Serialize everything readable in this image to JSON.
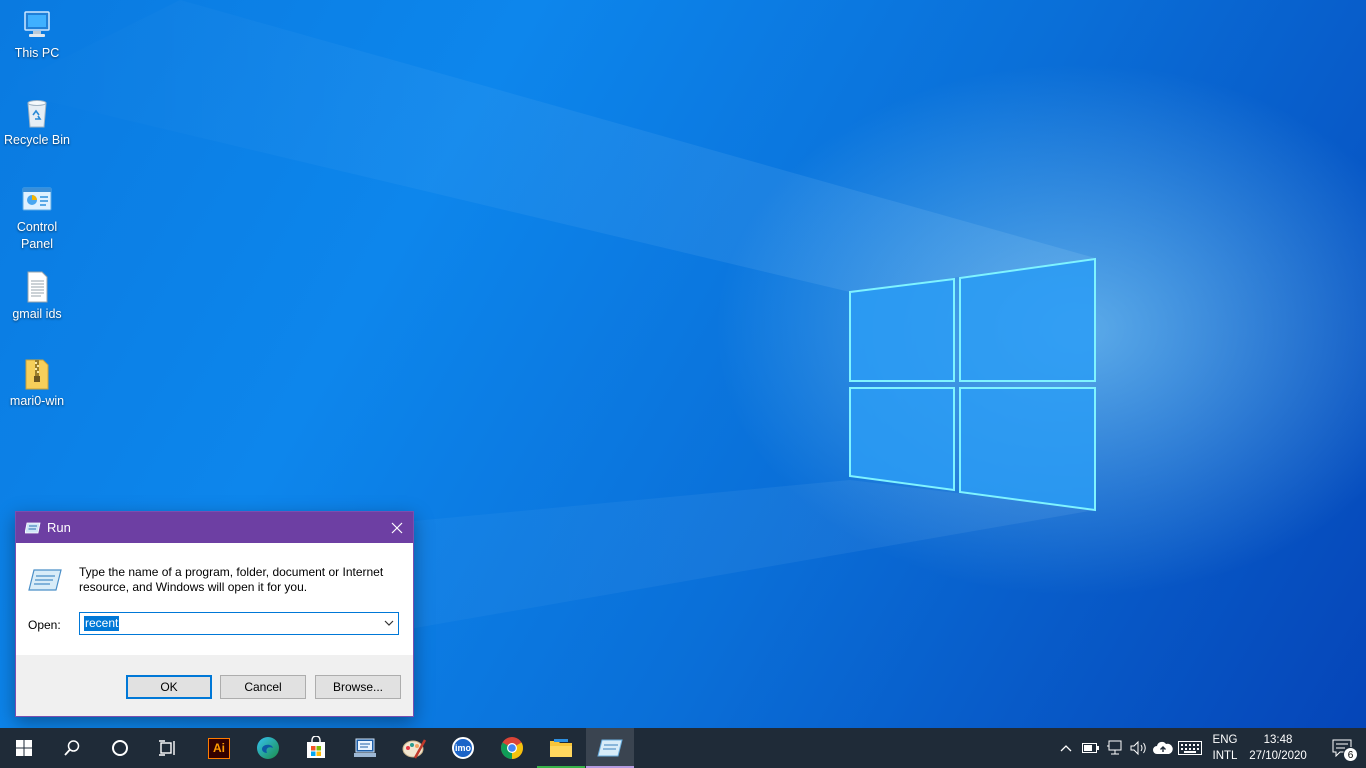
{
  "desktop": {
    "icons": [
      {
        "label": "This PC",
        "icon": "computer-icon"
      },
      {
        "label": "Recycle Bin",
        "icon": "recycle-bin-icon"
      },
      {
        "label": "Control Panel",
        "icon": "control-panel-icon"
      },
      {
        "label": "gmail ids",
        "icon": "text-document-icon"
      },
      {
        "label": "mari0-win",
        "icon": "zip-folder-icon"
      }
    ]
  },
  "run_dialog": {
    "title": "Run",
    "description": "Type the name of a program, folder, document or Internet resource, and Windows will open it for you.",
    "open_label": "Open:",
    "open_value": "recent",
    "ok_label": "OK",
    "cancel_label": "Cancel",
    "browse_label": "Browse..."
  },
  "taskbar": {
    "apps": [
      "start-icon",
      "search-icon",
      "cortana-icon",
      "task-view-icon",
      "illustrator-icon",
      "edge-icon",
      "store-icon",
      "network-config-icon",
      "paint-icon",
      "imo-icon",
      "chrome-icon",
      "file-explorer-icon",
      "run-icon"
    ],
    "illustrator_text": "Ai",
    "imo_text": "imo",
    "language": "ENG",
    "keyboard": "INTL",
    "time": "13:48",
    "date": "27/10/2020",
    "notification_count": "6"
  },
  "colors": {
    "titlebar": "#6d3fa3",
    "accent": "#0078d7",
    "taskbar": "#1f2b38"
  }
}
